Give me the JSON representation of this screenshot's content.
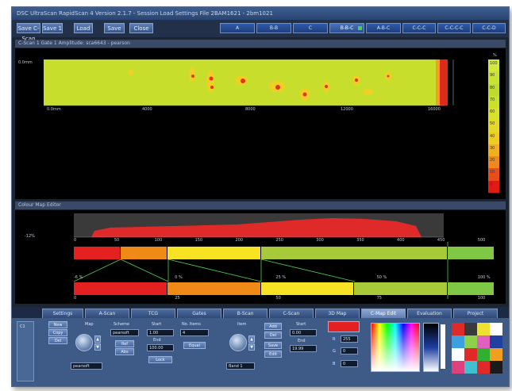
{
  "window": {
    "title": "DSC UltraScan RapidScan 4 Version 2.1.7 - Session Load Settings File 2BAM1621 - 2bm1021"
  },
  "toolbar": {
    "buttons": [
      "Save C-Scan",
      "Save 1",
      "Load",
      "Save",
      "Close"
    ],
    "views": [
      "A",
      "B-B",
      "C",
      "B-B-C",
      "A-B-C",
      "C-C-C",
      "C-C-C-C",
      "C-C-D"
    ],
    "active_view": "B-B-C"
  },
  "cscan": {
    "header": "C-Scan 1 Gate 1 Amplitude: sca6643 - pearson",
    "y_label": "0.0mm",
    "x_ticks": [
      "0.0mm",
      "4000",
      "8000",
      "12000",
      "16000"
    ],
    "legend_unit": "%",
    "legend_labels": [
      "100",
      "90",
      "80",
      "70",
      "60",
      "50",
      "40",
      "30",
      "20",
      "10",
      "0"
    ],
    "legend_colors": [
      "#d2e83a",
      "#c9e234",
      "#bddc2e",
      "#c8e22c",
      "#d8e12a",
      "#e6d925",
      "#f0cc22",
      "#f2b020",
      "#ee8a1c",
      "#e84f18",
      "#df1b14"
    ]
  },
  "colormap": {
    "header": "Colour Map Editor",
    "left_percent": "-12%",
    "scale_ticks": [
      "0",
      "50",
      "100",
      "150",
      "200",
      "250",
      "300",
      "350",
      "400",
      "450",
      "500"
    ],
    "upper_bar": [
      {
        "color": "#e32121",
        "fraction": 0.12
      },
      {
        "color": "#ef8a17",
        "fraction": 0.12
      },
      {
        "color": "#f7e223",
        "fraction": 0.24
      },
      {
        "color": "#a8c93a",
        "fraction": 0.48
      },
      {
        "color": "#7ec845",
        "fraction": 0.12
      }
    ],
    "pointer_labels": [
      "-6 %",
      "0 %",
      "25 %",
      "50 %",
      "100 %"
    ],
    "lower_bar": [
      {
        "color": "#e32121",
        "fraction": 0.24
      },
      {
        "color": "#ef8a17",
        "fraction": 0.24
      },
      {
        "color": "#f7e223",
        "fraction": 0.24
      },
      {
        "color": "#a8c93a",
        "fraction": 0.24
      },
      {
        "color": "#7ec845",
        "fraction": 0.12
      }
    ],
    "lower_ticks": [
      "0",
      "25",
      "50",
      "75",
      "100"
    ]
  },
  "tabs": {
    "labels": [
      "Settings",
      "A-Scan",
      "TCG",
      "Gates",
      "B-Scan",
      "C-Scan",
      "3D Map",
      "C-Map Edit",
      "Evaluation",
      "Project"
    ],
    "active": "C-Map Edit"
  },
  "controls": {
    "side_label": "C1",
    "file_buttons": [
      "New",
      "Copy",
      "Del"
    ],
    "map_label": "Map",
    "map_value": "pearsoft",
    "scheme_label": "Scheme",
    "scheme_value": "pearsoft",
    "scheme_buttons": [
      "Ref",
      "Abs"
    ],
    "start_label": "Start",
    "start_value": "1.00",
    "end_label": "End",
    "end_value": "100.00",
    "lock_button": "Lock",
    "no_items_label": "No. Items",
    "no_items_value": "4",
    "equal_button": "Equal",
    "item_label": "Item",
    "item_value": "Band 1",
    "item_buttons": [
      "Add",
      "Del",
      "Save",
      "Edit"
    ],
    "item_start_label": "Start",
    "item_start_value": "0.00",
    "item_end_label": "End",
    "item_end_value": "19.99",
    "rgb_labels": [
      "R",
      "G",
      "B"
    ],
    "rgb_values": [
      "255",
      "0",
      "0"
    ],
    "current_color": "#e32121"
  }
}
